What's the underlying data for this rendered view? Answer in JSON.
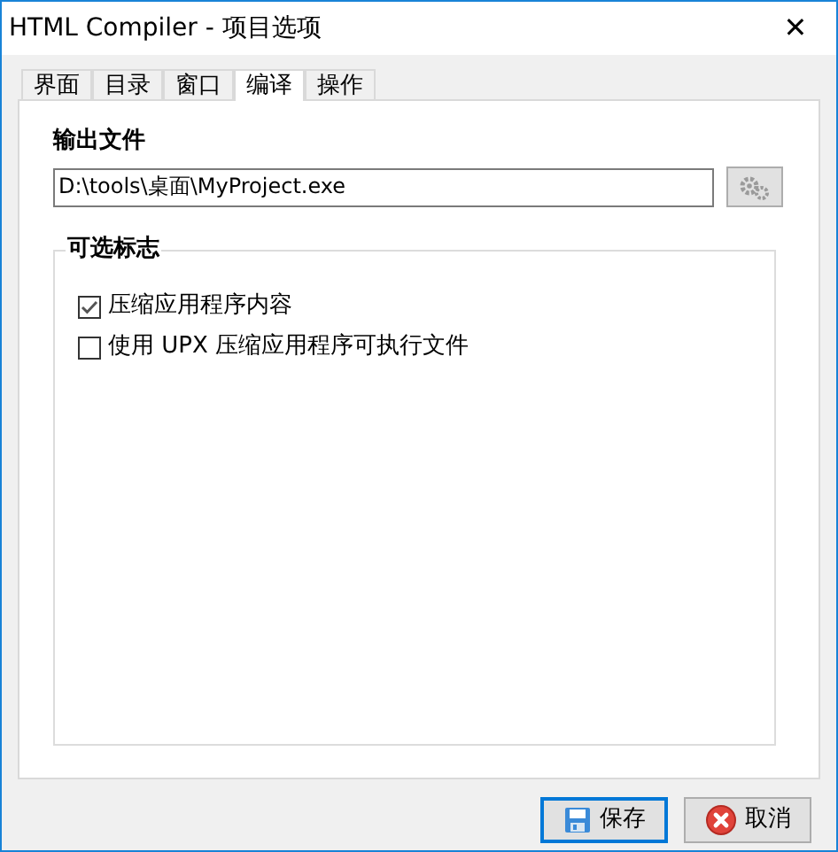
{
  "window": {
    "title": "HTML Compiler - 项目选项",
    "close": "✕"
  },
  "tabs": [
    {
      "label": "界面",
      "selected": false
    },
    {
      "label": "目录",
      "selected": false
    },
    {
      "label": "窗口",
      "selected": false
    },
    {
      "label": "编译",
      "selected": true
    },
    {
      "label": "操作",
      "selected": false
    }
  ],
  "output_file": {
    "label": "输出文件",
    "value": "D:\\tools\\桌面\\MyProject.exe"
  },
  "flags": {
    "title": "可选标志",
    "options": [
      {
        "label": "压缩应用程序内容",
        "checked": true
      },
      {
        "label": "使用 UPX 压缩应用程序可执行文件",
        "checked": false
      }
    ]
  },
  "buttons": [
    {
      "kind": "save",
      "label": "保存",
      "default": true
    },
    {
      "kind": "cancel",
      "label": "取消",
      "default": false
    }
  ]
}
